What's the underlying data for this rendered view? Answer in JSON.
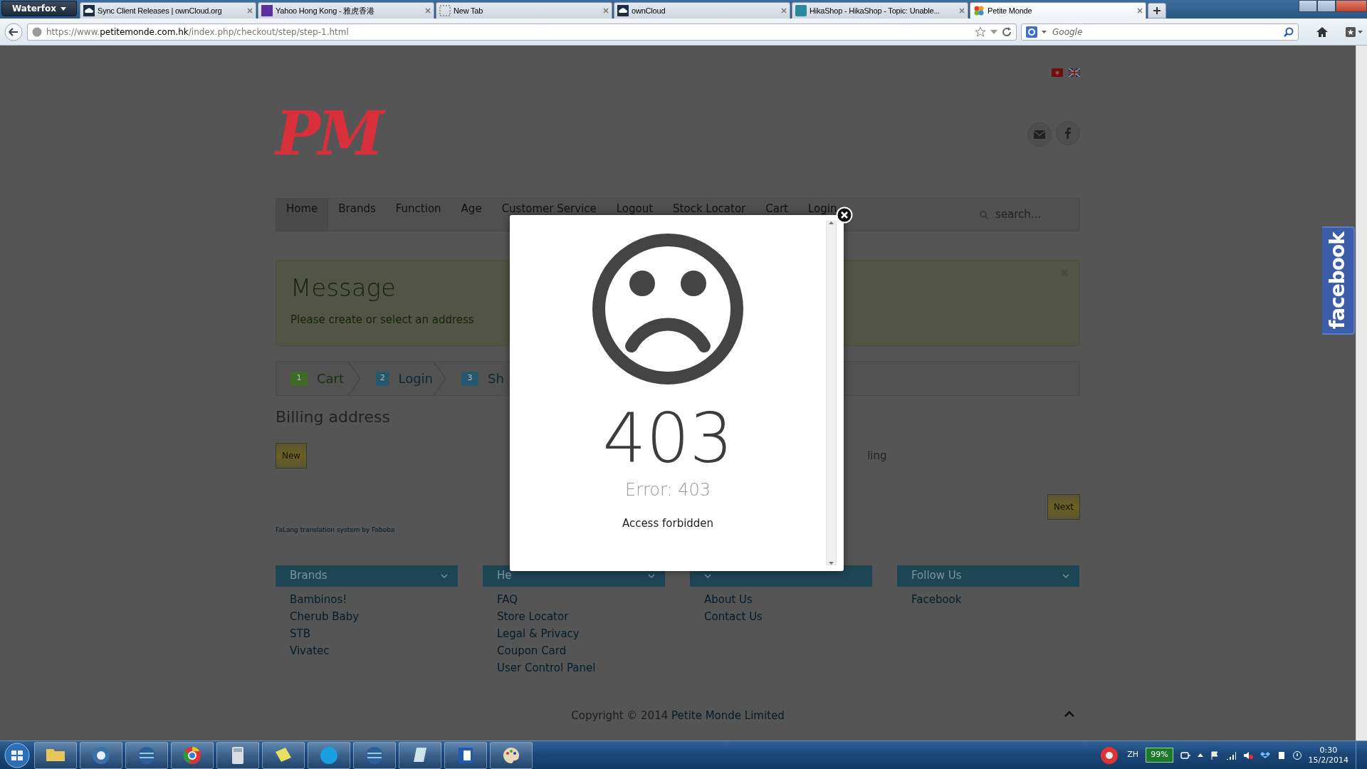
{
  "browser": {
    "menu_button": "Waterfox",
    "tabs": [
      {
        "title": "Sync Client Releases | ownCloud.org",
        "selected": false
      },
      {
        "title": "Yahoo Hong Kong - 雅虎香港",
        "selected": false
      },
      {
        "title": "New Tab",
        "selected": false
      },
      {
        "title": "ownCloud",
        "selected": false
      },
      {
        "title": "HikaShop - HikaShop - Topic: Unable...",
        "selected": false
      },
      {
        "title": "Petite Monde",
        "selected": true
      }
    ],
    "url": {
      "prefix": "https://www.",
      "domain": "petitemonde.com.hk",
      "path": "/index.php/checkout/step/step-1.html"
    },
    "search": {
      "placeholder": "Google"
    }
  },
  "header": {
    "logo": "PM"
  },
  "nav": {
    "items": [
      {
        "label": "Home",
        "selected": true
      },
      {
        "label": "Brands",
        "selected": false
      },
      {
        "label": "Function",
        "selected": false
      },
      {
        "label": "Age",
        "selected": false
      },
      {
        "label": "Customer Service",
        "selected": false
      },
      {
        "label": "Logout",
        "selected": false
      },
      {
        "label": "Stock Locator",
        "selected": false
      },
      {
        "label": "Cart",
        "selected": false
      },
      {
        "label": "Login",
        "selected": false
      }
    ],
    "search": {
      "placeholder": "search..."
    }
  },
  "message": {
    "title": "Message",
    "text": "Please create or select an address"
  },
  "steps": [
    {
      "number": "1",
      "label": "Cart",
      "color": "#3f6b25"
    },
    {
      "number": "2",
      "label": "Login",
      "color": "#23586e"
    },
    {
      "number": "3",
      "label": "Sh",
      "color": "#23586e"
    }
  ],
  "billing": {
    "title": "Billing address",
    "new_button": "New",
    "side_text": "ling",
    "next_button": "Next",
    "credit": "FaLang translation system by Faboba"
  },
  "footer": {
    "columns": [
      {
        "title": "Brands",
        "links": [
          "Bambinos!",
          "Cherub Baby",
          "STB",
          "Vivatec"
        ]
      },
      {
        "title": "He",
        "links": [
          "FAQ",
          "Store Locator",
          "Legal & Privacy",
          "Coupon Card",
          "User Control Panel"
        ]
      },
      {
        "links": [
          "About Us",
          "Contact Us"
        ]
      },
      {
        "title": "Follow Us",
        "links": [
          "Facebook"
        ]
      }
    ],
    "copyright": "Copyright © 2014",
    "company": "Petite Monde Limited"
  },
  "side_tab": {
    "label": "facebook"
  },
  "modal": {
    "code": "403",
    "error": "Error: 403",
    "message": "Access forbidden"
  },
  "taskbar": {
    "language": "ZH",
    "battery": "99%",
    "time": "0:30",
    "date": "15/2/2014"
  }
}
